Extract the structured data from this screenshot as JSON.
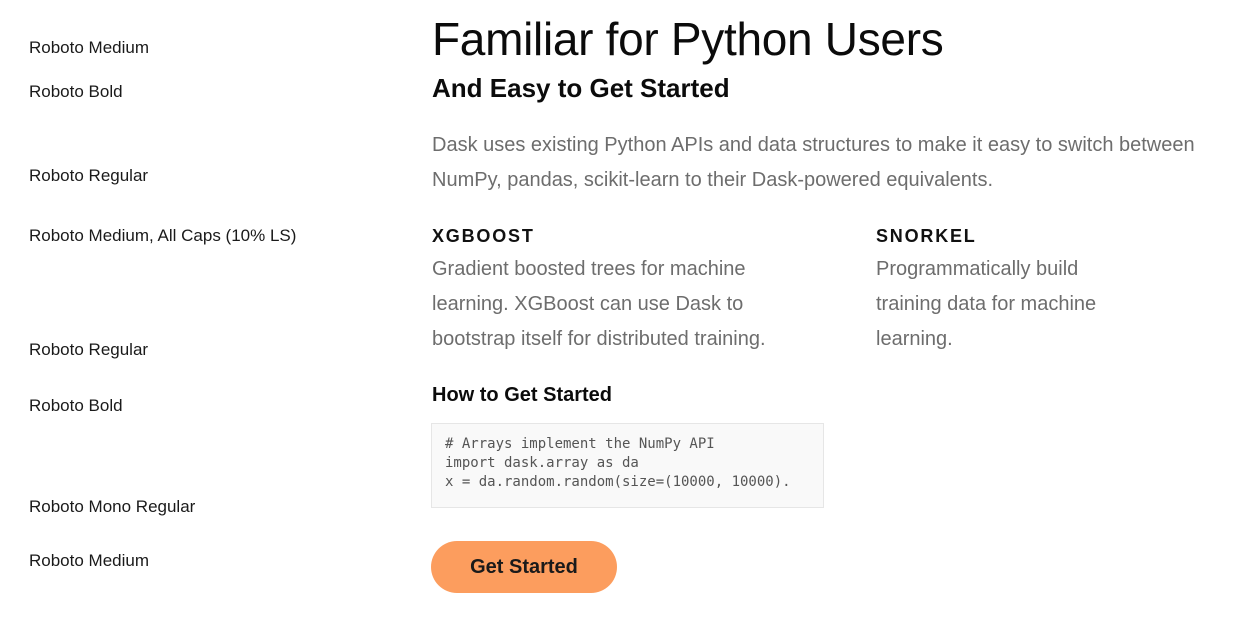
{
  "annotations": [
    "Roboto Medium",
    "Roboto Bold",
    "Roboto Regular",
    "Roboto Medium, All Caps (10% LS)",
    "Roboto Regular",
    "Roboto Bold",
    "Roboto Mono Regular",
    "Roboto Medium"
  ],
  "hero": {
    "title": "Familiar for Python Users",
    "subtitle": "And Easy to Get Started",
    "lead": "Dask uses existing Python APIs and data structures to make it easy to switch between NumPy, pandas, scikit-learn to their Dask-powered equivalents."
  },
  "features": [
    {
      "title": "XGBOOST",
      "description": "Gradient boosted trees for machine learning. XGBoost can use Dask to bootstrap itself for distributed training."
    },
    {
      "title": "SNORKEL",
      "description": "Programmatically build training data for machine learning."
    }
  ],
  "getting_started": {
    "heading": "How to Get Started",
    "code_lines": [
      "# Arrays implement the NumPy API",
      "import dask.array as da",
      "x = da.random.random(size=(10000, 10000)."
    ]
  },
  "cta": {
    "label": "Get Started",
    "color": "#fc9d5e"
  }
}
